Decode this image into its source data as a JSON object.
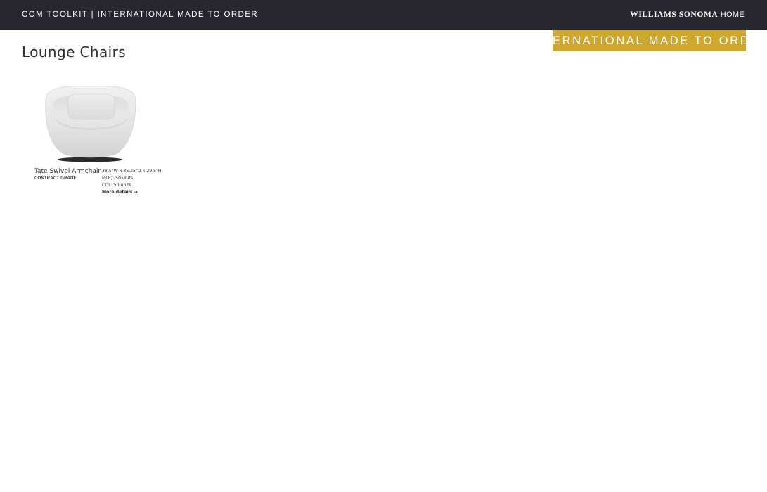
{
  "header": {
    "title": "COM Toolkit | International Made to Order",
    "brand_main": "WILLIAMS SONOMA",
    "brand_sub": "HOME",
    "background_color": "#27272f"
  },
  "badge": {
    "label": "International Made to Order",
    "color": "#cfa82f"
  },
  "page": {
    "title": "Lounge Chairs"
  },
  "products": [
    {
      "name": "Tate Swivel Armchair",
      "grade": "Contract Grade",
      "dimensions": "38.5\"W x 35.25\"D x 29.5\"H",
      "moq": "MOQ: 50 units",
      "col": "COL: 50 units",
      "details_label": "More details →",
      "image_icon": "swivel-armchair-image"
    }
  ]
}
